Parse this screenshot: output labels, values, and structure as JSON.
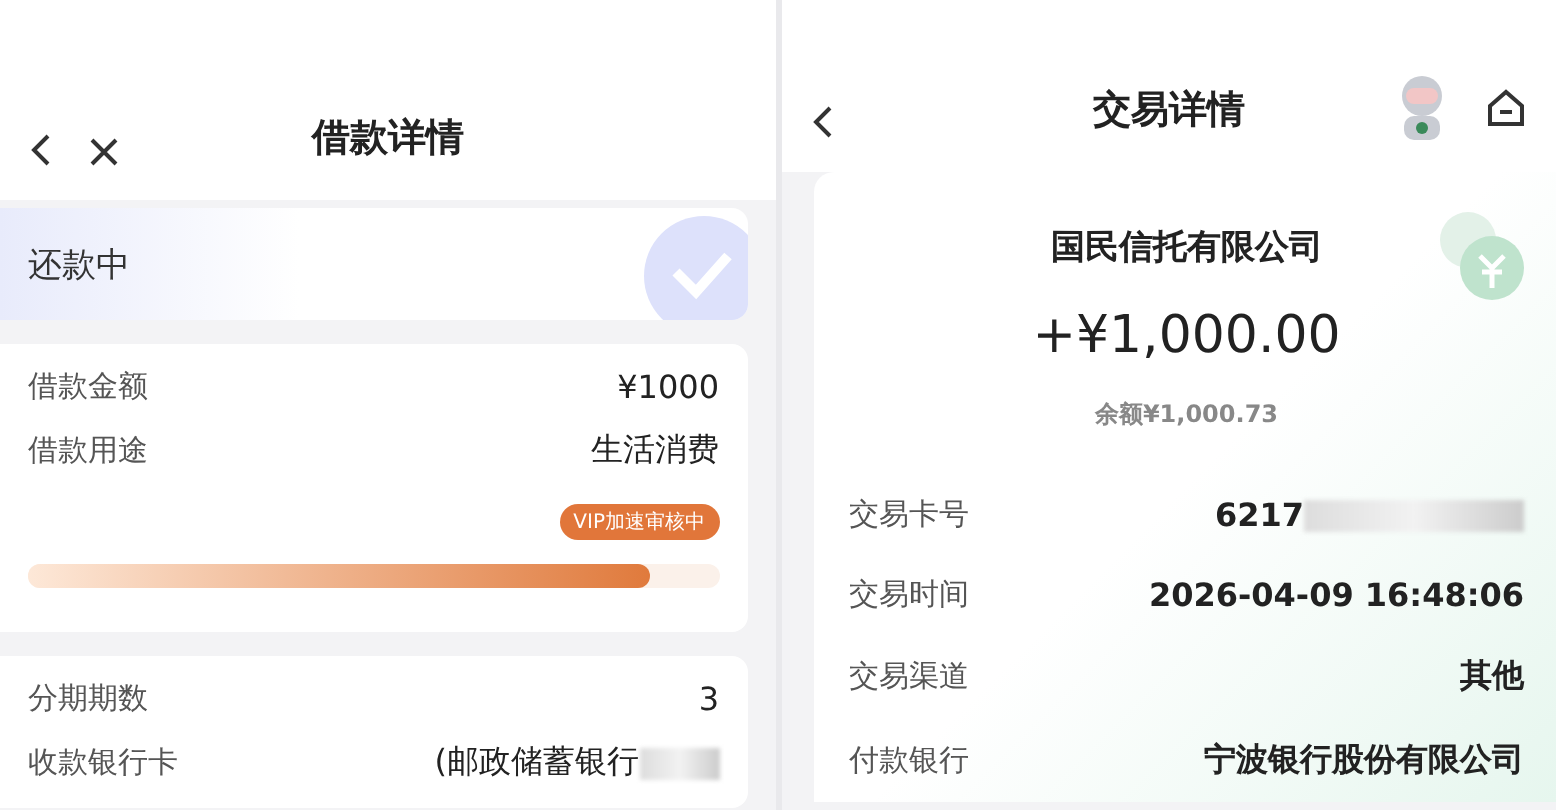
{
  "left": {
    "title": "借款详情",
    "status": {
      "label": "还款中"
    },
    "loan": [
      {
        "label": "借款金额",
        "value": "¥1000"
      },
      {
        "label": "借款用途",
        "value": "生活消费"
      }
    ],
    "progress": {
      "badge": "VIP加速审核中",
      "level": 0.9
    },
    "details": [
      {
        "label": "分期期数",
        "value": "3",
        "redacted": false
      },
      {
        "label": "收款银行卡",
        "value": "(邮政储蓄银行",
        "redacted": true
      }
    ]
  },
  "right": {
    "title": "交易详情",
    "company": "国民信托有限公司",
    "amount": "+¥1,000.00",
    "balance": "余额¥1,000.73",
    "rows": [
      {
        "label": "交易卡号",
        "value": "6217",
        "redacted": true
      },
      {
        "label": "交易时间",
        "value": "2026-04-09 16:48:06",
        "redacted": false
      },
      {
        "label": "交易渠道",
        "value": "其他",
        "redacted": false
      },
      {
        "label": "付款银行",
        "value": "宁波银行股份有限公司",
        "redacted": false
      }
    ]
  }
}
